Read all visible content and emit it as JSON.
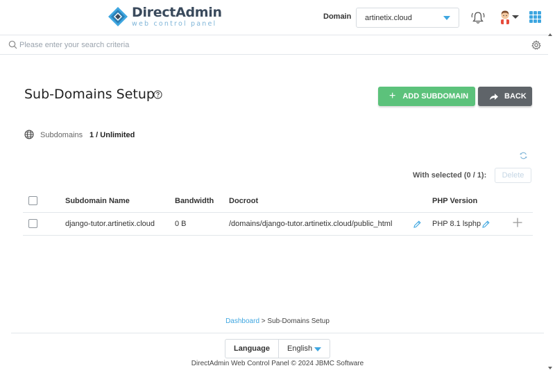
{
  "header": {
    "logo_title": "DirectAdmin",
    "logo_subtitle": "web control panel",
    "domain_label": "Domain",
    "domain_value": "artinetix.cloud"
  },
  "search": {
    "placeholder": "Please enter your search criteria"
  },
  "page": {
    "title": "Sub-Domains Setup",
    "add_button": "ADD SUBDOMAIN",
    "back_button": "BACK",
    "stat_label": "Subdomains",
    "stat_value": "1 / Unlimited",
    "with_selected": "With selected (0 / 1):",
    "delete_button": "Delete"
  },
  "table": {
    "columns": [
      "Subdomain Name",
      "Bandwidth",
      "Docroot",
      "PHP Version"
    ],
    "rows": [
      {
        "name": "django-tutor.artinetix.cloud",
        "bandwidth": "0 B",
        "docroot": "/domains/django-tutor.artinetix.cloud/public_html",
        "php_version": "PHP 8.1 lsphp"
      }
    ]
  },
  "breadcrumb": {
    "home": "Dashboard",
    "separator": " > ",
    "current": "Sub-Domains Setup"
  },
  "footer": {
    "language_label": "Language",
    "language_value": "English",
    "copyright": "DirectAdmin Web Control Panel © 2024 JBMC Software"
  },
  "colors": {
    "accent": "#3ea6e0",
    "add_button": "#5cc27b",
    "back_button": "#5f6469"
  }
}
